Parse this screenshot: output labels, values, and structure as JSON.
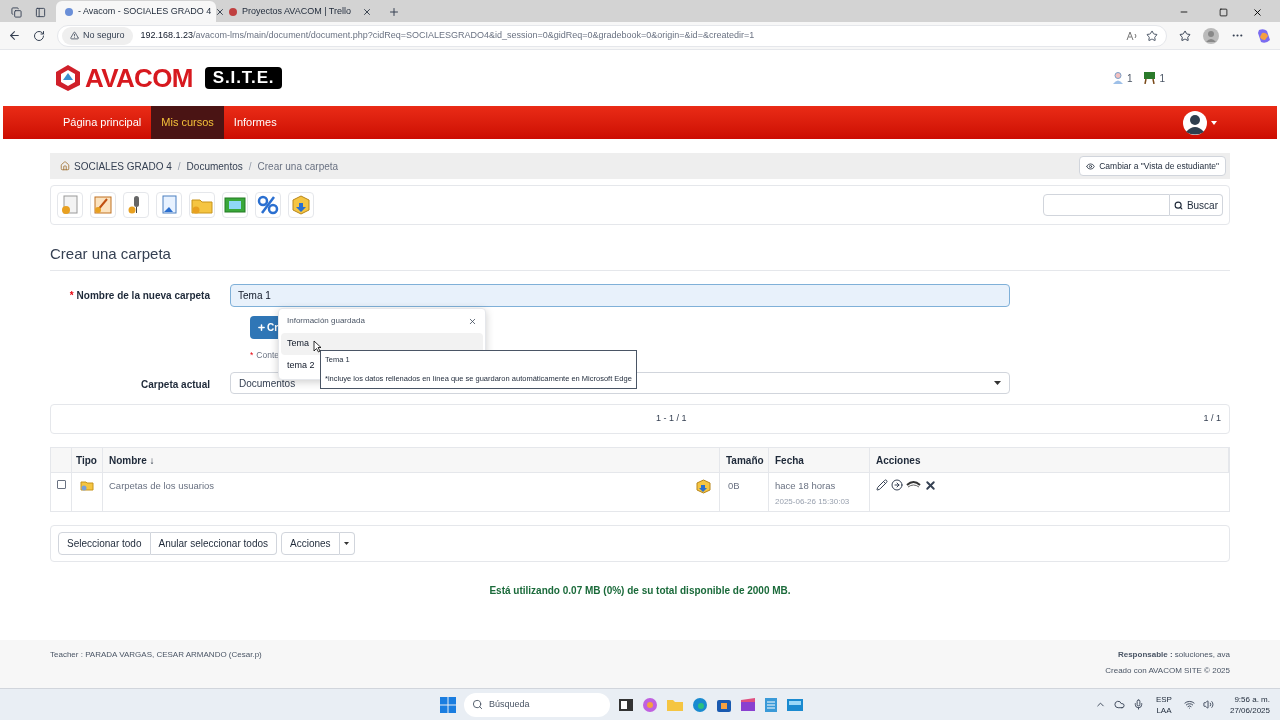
{
  "browser": {
    "tabs": [
      {
        "title": "- Avacom - SOCIALES GRADO 4",
        "selected": true
      },
      {
        "title": "Proyectos AVACOM | Trello",
        "selected": false
      }
    ],
    "security": "No seguro",
    "url_host": "192.168.1.23",
    "url_path": "/avacom-lms/main/document/document.php?cidReq=SOCIALESGRADO4&id_session=0&gidReq=0&gradebook=0&origin=&id=&createdir=1"
  },
  "header": {
    "logo_text": "AVACOM",
    "logo_badge": "S.I.T.E.",
    "counters": [
      {
        "kind": "users",
        "count": "1"
      },
      {
        "kind": "courses",
        "count": "1"
      }
    ]
  },
  "nav": {
    "items": [
      {
        "label": "Página principal",
        "selected": false
      },
      {
        "label": "Mis cursos",
        "selected": true
      },
      {
        "label": "Informes",
        "selected": false
      }
    ]
  },
  "breadcrumb": {
    "separator": "/",
    "items": [
      "SOCIALES GRADO 4",
      "Documentos",
      "Crear una carpeta"
    ],
    "student_view_button": "Cambiar a \"Vista de estudiante\""
  },
  "search": {
    "button": "Buscar"
  },
  "form": {
    "required_mark": "*",
    "title": "Crear una carpeta",
    "name_label": "Nombre de la nueva carpeta",
    "name_value": "Tema 1",
    "create_button": "Cr",
    "hint": "Conte",
    "folder_label": "Carpeta actual",
    "folder_value": "Documentos"
  },
  "autofill": {
    "header": "Información guardada",
    "items": [
      {
        "label": "Tema",
        "selected": true
      },
      {
        "label": "tema 2",
        "selected": false
      }
    ],
    "tooltip_title": "Tema 1",
    "tooltip_note": "*incluye los datos rellenados en línea que se guardaron automáticamente en Microsoft Edge"
  },
  "pagination": {
    "center": "1 - 1 / 1",
    "right": "1 / 1"
  },
  "table": {
    "columns": [
      "Tipo",
      "Nombre ↓",
      "Tamaño",
      "Fecha",
      "Acciones"
    ],
    "rows": [
      {
        "checked": false,
        "name": "Carpetas de los usuarios",
        "size": "0B",
        "date": "hace 18 horas",
        "timestamp": "2025-06-26 15:30:03"
      }
    ]
  },
  "bulk_buttons": [
    "Seleccionar todo",
    "Anular seleccionar todos",
    "Acciones"
  ],
  "quota": "Está utilizando 0.07 MB (0%) de su total disponible de 2000 MB.",
  "footer": {
    "teacher": "Teacher : PARADA VARGAS, CESAR ARMANDO (Cesar.p)",
    "responsible": "**Responsable :** soluciones, ava",
    "credit": "Creado con AVACOM SITE © 2025"
  },
  "taskbar": {
    "search_placeholder": "Búsqueda",
    "lang": "ESP",
    "region": "LAA",
    "time": "9:56 a. m.",
    "date": "27/06/2025"
  }
}
